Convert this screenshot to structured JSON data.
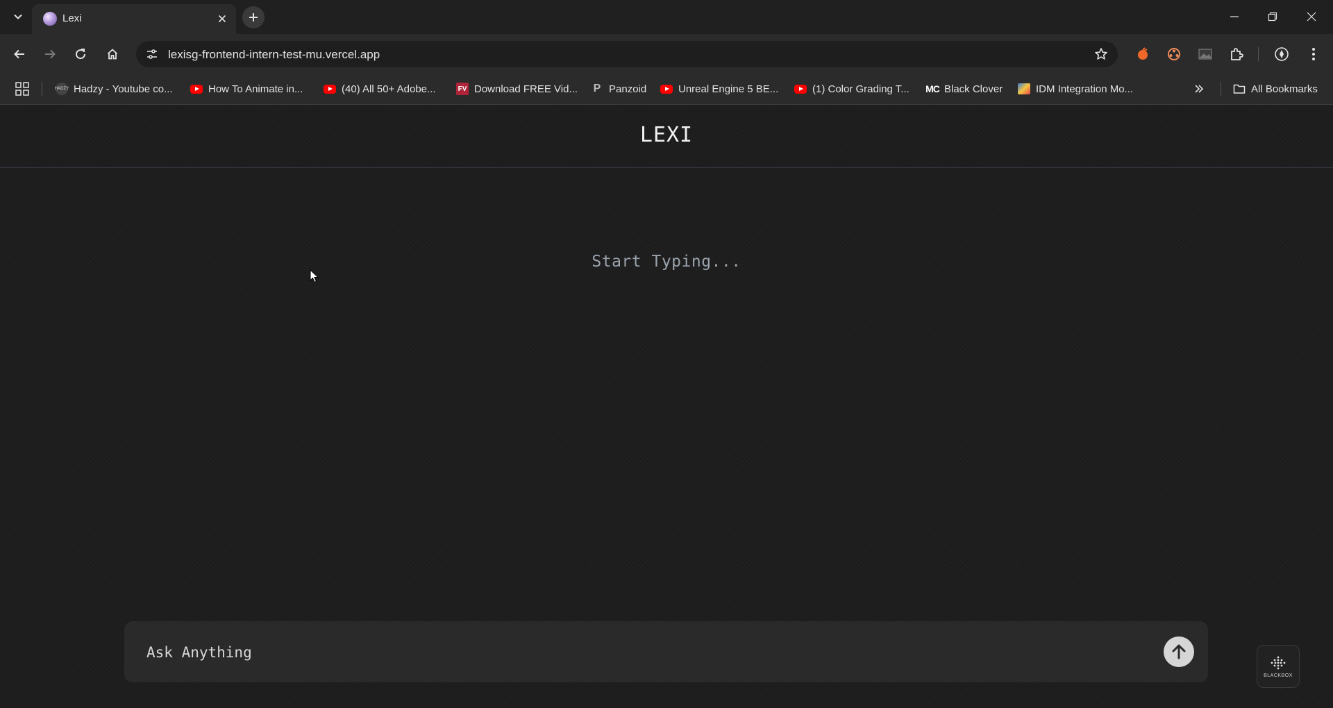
{
  "browser": {
    "tab": {
      "title": "Lexi"
    },
    "address_bar": {
      "url": "lexisg-frontend-intern-test-mu.vercel.app"
    },
    "bookmarks": [
      {
        "label": "Hadzy - Youtube co...",
        "icon": "hadzy-icon"
      },
      {
        "label": "How To Animate in...",
        "icon": "youtube-icon"
      },
      {
        "label": "(40) All 50+ Adobe...",
        "icon": "youtube-icon"
      },
      {
        "label": "Download FREE Vid...",
        "icon": "fv-icon"
      },
      {
        "label": "Panzoid",
        "icon": "panzoid-icon"
      },
      {
        "label": "Unreal Engine 5 BE...",
        "icon": "youtube-icon"
      },
      {
        "label": "(1) Color Grading T...",
        "icon": "youtube-icon"
      },
      {
        "label": "Black Clover",
        "icon": "mc-icon"
      },
      {
        "label": "IDM Integration Mo...",
        "icon": "idm-icon"
      }
    ],
    "all_bookmarks_label": "All Bookmarks",
    "fv_text": "FV",
    "mc_text": "MC",
    "panzoid_text": "P"
  },
  "app": {
    "title": "LEXI",
    "empty_state": "Start Typing...",
    "input_placeholder": "Ask Anything",
    "widget_label": "BLACKBOX"
  },
  "colors": {
    "page_bg": "#1c1c1c",
    "chat_box_bg": "#2a2a2a",
    "send_button": "#d6d6d6"
  }
}
